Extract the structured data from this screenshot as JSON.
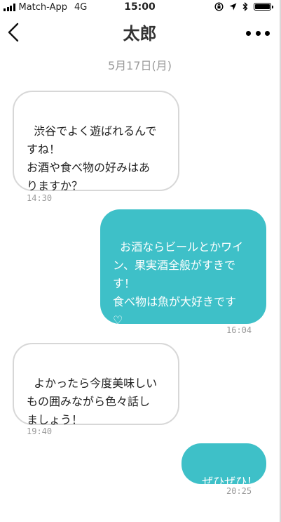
{
  "status_bar": {
    "carrier": "Match-App",
    "network": "4G",
    "time": "15:00",
    "icons": [
      "signal-icon",
      "orientation-lock-icon",
      "location-icon",
      "bluetooth-icon",
      "battery-icon"
    ]
  },
  "header": {
    "title": "太郎",
    "back_icon": "chevron-left-icon",
    "more_icon": "more-icon"
  },
  "date_label": "5月17日(月)",
  "colors": {
    "outgoing_bubble": "#3ec0c8",
    "incoming_border": "#d7d7d7",
    "timestamp": "#999999"
  },
  "messages": [
    {
      "direction": "incoming",
      "text": "渋谷でよく遊ばれるんで\nすね！\nお酒や食べ物の好みはあ\nりますか？",
      "time": "14:30"
    },
    {
      "direction": "outgoing",
      "text": "お酒ならビールとかワイ\nン、果実酒全般がすきで\nす！\n食べ物は魚が大好きです\n♡",
      "time": "16:04"
    },
    {
      "direction": "incoming",
      "text": "よかったら今度美味しい\nもの囲みながら色々話し\nましょう！",
      "time": "19:40"
    },
    {
      "direction": "outgoing",
      "text": "ぜひぜひ！",
      "time": "20:25"
    }
  ]
}
